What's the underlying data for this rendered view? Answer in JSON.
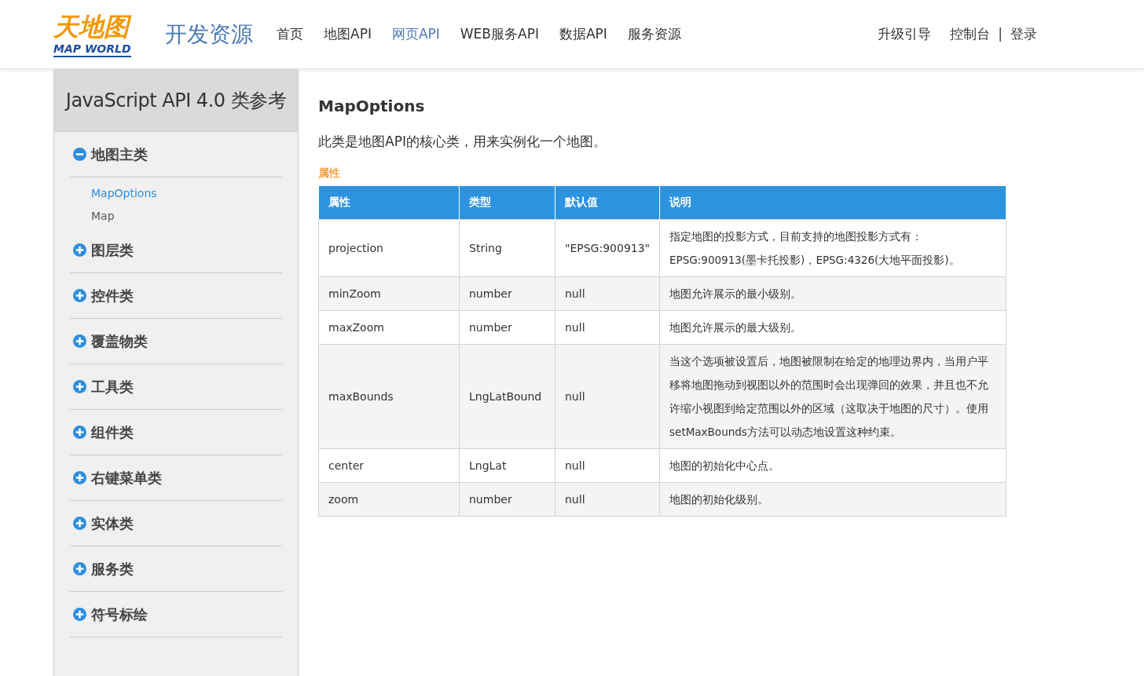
{
  "logo": {
    "mark": "天地图",
    "wordmark": "MAP WORLD"
  },
  "site_title": "开发资源",
  "nav": [
    {
      "label": "首页",
      "selected": false
    },
    {
      "label": "地图API",
      "selected": false
    },
    {
      "label": "网页API",
      "selected": true
    },
    {
      "label": "WEB服务API",
      "selected": false
    },
    {
      "label": "数据API",
      "selected": false
    },
    {
      "label": "服务资源",
      "selected": false
    }
  ],
  "user_links": {
    "upgrade": "升级引导",
    "console": "控制台",
    "separator": "|",
    "login": "登录"
  },
  "sidebar": {
    "title": "JavaScript API 4.0 类参考",
    "groups": [
      {
        "label": "地图主类",
        "expanded": true,
        "children": [
          {
            "label": "MapOptions",
            "selected": true
          },
          {
            "label": "Map",
            "selected": false
          }
        ]
      },
      {
        "label": "图层类",
        "expanded": false
      },
      {
        "label": "控件类",
        "expanded": false
      },
      {
        "label": "覆盖物类",
        "expanded": false
      },
      {
        "label": "工具类",
        "expanded": false
      },
      {
        "label": "组件类",
        "expanded": false
      },
      {
        "label": "右键菜单类",
        "expanded": false
      },
      {
        "label": "实体类",
        "expanded": false
      },
      {
        "label": "服务类",
        "expanded": false
      },
      {
        "label": "符号标绘",
        "expanded": false
      }
    ]
  },
  "content": {
    "title": "MapOptions",
    "description": "此类是地图API的核心类，用来实例化一个地图。",
    "section": "属性",
    "table": {
      "columns": [
        "属性",
        "类型",
        "默认值",
        "说明"
      ],
      "rows": [
        [
          "projection",
          "String",
          "\"EPSG:900913\"",
          "指定地图的投影方式，目前支持的地图投影方式有：EPSG:900913(墨卡托投影)，EPSG:4326(大地平面投影)。"
        ],
        [
          "minZoom",
          "number",
          "null",
          "地图允许展示的最小级别。"
        ],
        [
          "maxZoom",
          "number",
          "null",
          "地图允许展示的最大级别。"
        ],
        [
          "maxBounds",
          "LngLatBound",
          "null",
          "当这个选项被设置后，地图被限制在给定的地理边界内，当用户平移将地图拖动到视图以外的范围时会出现弹回的效果，并且也不允许缩小视图到给定范围以外的区域（这取决于地图的尺寸）。使用setMaxBounds方法可以动态地设置这种约束。"
        ],
        [
          "center",
          "LngLat",
          "null",
          "地图的初始化中心点。"
        ],
        [
          "zoom",
          "number",
          "null",
          "地图的初始化级别。"
        ]
      ]
    }
  }
}
